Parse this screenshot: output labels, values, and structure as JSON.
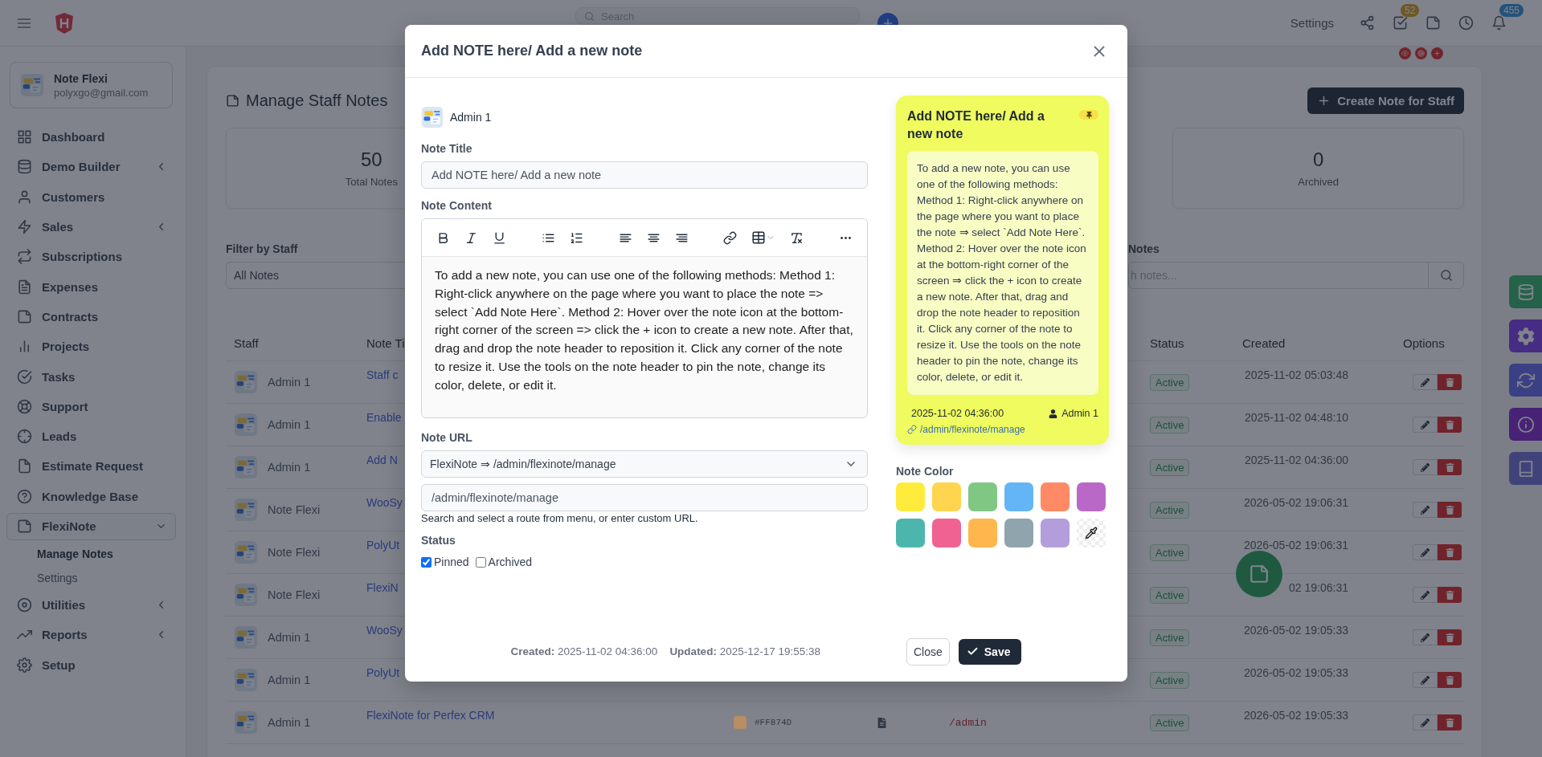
{
  "topbar": {
    "search_placeholder": "Search",
    "settings_label": "Settings",
    "icons": [
      {
        "kind": "share"
      },
      {
        "kind": "tasks",
        "badge": "52"
      },
      {
        "kind": "note"
      },
      {
        "kind": "clock"
      },
      {
        "kind": "bell",
        "badge": "455"
      }
    ]
  },
  "profile": {
    "name": "Note Flexi",
    "email": "polyxgo@gmail.com"
  },
  "sidebar": {
    "items": [
      {
        "label": "Dashboard",
        "selected": false
      },
      {
        "label": "Demo Builder",
        "selected": false,
        "expanded": false
      },
      {
        "label": "Customers",
        "selected": false
      },
      {
        "label": "Sales",
        "selected": false,
        "expanded": false
      },
      {
        "label": "Subscriptions",
        "selected": false
      },
      {
        "label": "Expenses",
        "selected": false
      },
      {
        "label": "Contracts",
        "selected": false
      },
      {
        "label": "Projects",
        "selected": false
      },
      {
        "label": "Tasks",
        "selected": false
      },
      {
        "label": "Support",
        "selected": false
      },
      {
        "label": "Leads",
        "selected": false
      },
      {
        "label": "Estimate Request",
        "selected": false
      },
      {
        "label": "Knowledge Base",
        "selected": false
      },
      {
        "label": "FlexiNote",
        "selected": true,
        "expanded": true,
        "children": [
          {
            "label": "Manage Notes",
            "selected": true
          },
          {
            "label": "Settings",
            "selected": false
          }
        ]
      },
      {
        "label": "Utilities",
        "selected": false,
        "expanded": false
      },
      {
        "label": "Reports",
        "selected": false,
        "expanded": false
      },
      {
        "label": "Setup",
        "selected": false
      }
    ]
  },
  "page": {
    "title": "Manage Staff Notes",
    "create_button": "Create Note for Staff",
    "stats": [
      {
        "value": "50",
        "label": "Total Notes"
      },
      {
        "value": "0",
        "label": "Archived"
      }
    ],
    "filters": {
      "staff_label": "Filter by Staff",
      "staff_value": "All Notes",
      "search_label": "Notes",
      "search_placeholder": "h notes..."
    },
    "table": {
      "columns": [
        "Staff",
        "Note Ti",
        "Status",
        "Created",
        "Options"
      ],
      "rows": [
        {
          "staff": "Admin 1",
          "title": "Staff c",
          "status": "Active",
          "created": "2025-11-02 05:03:48"
        },
        {
          "staff": "Admin 1",
          "title": "Enable",
          "status": "Active",
          "created": "2025-11-02 04:48:10"
        },
        {
          "staff": "Admin 1",
          "title": "Add N",
          "status": "Active",
          "created": "2025-11-02 04:36:00"
        },
        {
          "staff": "Note Flexi",
          "title": "WooSy",
          "status": "Active",
          "created": "2026-05-02 19:06:31"
        },
        {
          "staff": "Note Flexi",
          "title": "PolyUt",
          "status": "Active",
          "created": "2026-05-02 19:06:31"
        },
        {
          "staff": "Note Flexi",
          "title": "FlexiN",
          "status": "Active",
          "created": "02 19:06:31"
        },
        {
          "staff": "Admin 1",
          "title": "WooSy",
          "status": "Active",
          "created": "2026-05-02 19:05:33"
        },
        {
          "staff": "Admin 1",
          "title": "PolyUt",
          "status": "Active",
          "created": "2026-05-02 19:05:33"
        },
        {
          "staff": "Admin 1",
          "title": "FlexiNote for Perfex CRM",
          "color": "#b98e62",
          "color_code": "#FF874D",
          "url": "/admin",
          "status": "Active",
          "created": "2026-05-02 19:05:33"
        }
      ]
    }
  },
  "modal": {
    "title": "Add NOTE here/ Add a new note",
    "staff": "Admin 1",
    "title_label": "Note Title",
    "title_value": "Add NOTE here/ Add a new note",
    "content_label": "Note Content",
    "content": "To add a new note, you can use one of the following methods: Method 1: Right-click anywhere on the page where you want to place the note => select `Add Note Here`. Method 2: Hover over the note icon at the bottom-right corner of the screen => click the + icon to create a new note. After that, drag and drop the note header to reposition it. Click any corner of the note to resize it. Use the tools on the note header to pin the note, change its color, delete, or edit it.",
    "url_label": "Note URL",
    "route": "FlexiNote ⇒ /admin/flexinote/manage",
    "url_value": "/admin/flexinote/manage",
    "url_help": "Search and select a route from menu, or enter custom URL.",
    "status_label": "Status",
    "options": [
      {
        "label": "Pinned",
        "checked": true
      },
      {
        "label": "Archived",
        "checked": false
      }
    ],
    "created": "**Created:** 2025-11-02 04:36:00",
    "updated": "**Updated:** 2025-12-17 19:55:38",
    "close": "Close",
    "save": "Save",
    "preview": {
      "title": "Add NOTE here/ Add a new note",
      "pinned": true,
      "body": "To add a new note, you can use one of the following methods: Method 1: Right-click anywhere on the page where you want to place the note ⇒ select `Add Note Here`. Method 2: Hover over the note icon at the bottom-right corner of the screen ⇒ click the + icon to create a new note. After that, drag and drop the note header to reposition it. Click any corner of the note to resize it. Use the tools on the note header to pin the note, change its color, delete, or edit it.",
      "date": "2025-11-02 04:36:00",
      "author": "Admin 1",
      "url": "/admin/flexinote/manage"
    },
    "color_label": "Note Color",
    "swatches": [
      {
        "kind": "color",
        "color": "#ffeb3b",
        "selected": false
      },
      {
        "kind": "color",
        "color": "#ffd54f",
        "selected": false
      },
      {
        "kind": "color",
        "color": "#81c784",
        "selected": false
      },
      {
        "kind": "color",
        "color": "#64b5f6",
        "selected": false
      },
      {
        "kind": "color",
        "color": "#ff8a65",
        "selected": false
      },
      {
        "kind": "color",
        "color": "#ba68c8",
        "selected": false
      },
      {
        "kind": "color",
        "color": "#4db6ac",
        "selected": false
      },
      {
        "kind": "color",
        "color": "#f06292",
        "selected": false
      },
      {
        "kind": "color",
        "color": "#ffb74d",
        "selected": false
      },
      {
        "kind": "color",
        "color": "#90a4ae",
        "selected": false
      },
      {
        "kind": "color",
        "color": "#b39ddb",
        "selected": false
      },
      {
        "kind": "custom",
        "selected": false
      }
    ]
  }
}
